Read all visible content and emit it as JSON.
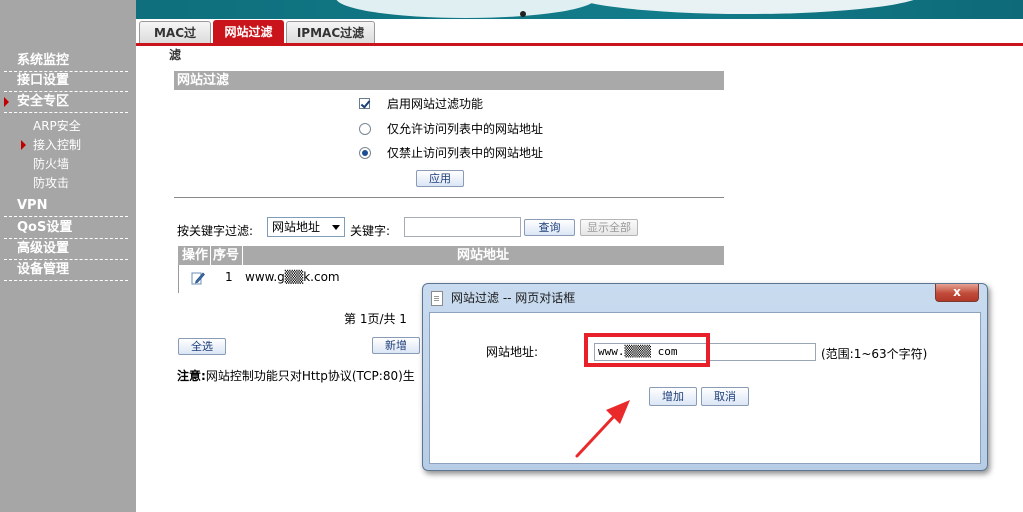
{
  "sidebar": {
    "main_items": [
      {
        "label": "系统监控"
      },
      {
        "label": "接口设置"
      },
      {
        "label": "安全专区"
      },
      {
        "label": "VPN"
      },
      {
        "label": "QoS设置"
      },
      {
        "label": "高级设置"
      },
      {
        "label": "设备管理"
      }
    ],
    "sub_items": [
      {
        "label": "ARP安全"
      },
      {
        "label": "接入控制"
      },
      {
        "label": "防火墙"
      },
      {
        "label": "防攻击"
      }
    ]
  },
  "tabs": [
    {
      "label": "MAC过滤"
    },
    {
      "label": "网站过滤"
    },
    {
      "label": "IPMAC过滤"
    }
  ],
  "filter": {
    "title": "网站过滤",
    "enable_label": "启用网站过滤功能",
    "allow_label": "仅允许访问列表中的网站地址",
    "deny_label": "仅禁止访问列表中的网站地址",
    "apply_label": "应用"
  },
  "search": {
    "label": "按关键字过滤:",
    "select_value": "网站地址",
    "keyword_label": "关键字:",
    "query_label": "查询",
    "show_all_label": "显示全部"
  },
  "table": {
    "headers": [
      "操作",
      "序号",
      "网站地址"
    ],
    "rows": [
      {
        "seq": "1",
        "url": "www.g▒▒k.com"
      }
    ]
  },
  "pager": "第 1页/共 1",
  "select_all_label": "全选",
  "add_label": "新增",
  "note": {
    "bold": "注意:",
    "text": "网站控制功能只对Http协议(TCP:80)生"
  },
  "dialog": {
    "title": "网站过滤 -- 网页对话框",
    "close": "x",
    "field_label": "网站地址:",
    "field_value": "www.▒▒▒▒ com",
    "range": "(范围:1~63个字符)",
    "add_label": "增加",
    "cancel_label": "取消"
  }
}
